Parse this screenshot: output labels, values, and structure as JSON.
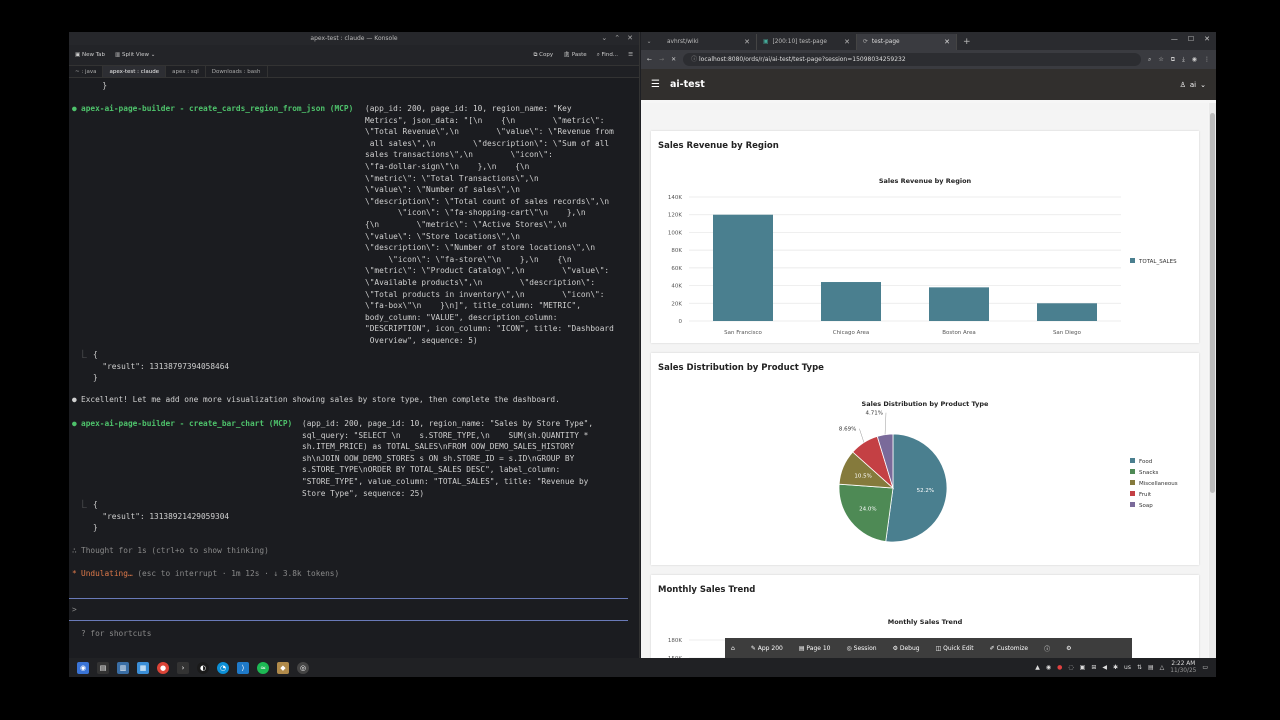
{
  "terminal": {
    "window_title": "apex-test : claude — Konsole",
    "toolbar": {
      "new_tab": "New Tab",
      "split_view": "Split View",
      "copy": "Copy",
      "paste": "Paste",
      "find": "Find..."
    },
    "tabs": [
      "~ : java",
      "apex-test : claude",
      "apex : sql",
      "Downloads : bash"
    ],
    "active_tab": "apex-test : claude",
    "lines": {
      "l0": "  }",
      "call1_name": "apex-ai-page-builder - create_cards_region_from_json (MCP)",
      "call1_args": [
        "(app_id: 200, page_id: 10, region_name: \"Key",
        "Metrics\", json_data: \"[\\n    {\\n        \\\"metric\\\":",
        "\\\"Total Revenue\\\",\\n        \\\"value\\\": \\\"Revenue from",
        " all sales\\\",\\n        \\\"description\\\": \\\"Sum of all",
        "sales transactions\\\",\\n        \\\"icon\\\":",
        "\\\"fa-dollar-sign\\\"\\n    },\\n    {\\n",
        "\\\"metric\\\": \\\"Total Transactions\\\",\\n",
        "\\\"value\\\": \\\"Number of sales\\\",\\n",
        "\\\"description\\\": \\\"Total count of sales records\\\",\\n",
        "       \\\"icon\\\": \\\"fa-shopping-cart\\\"\\n    },\\n",
        "{\\n        \\\"metric\\\": \\\"Active Stores\\\",\\n",
        "\\\"value\\\": \\\"Store locations\\\",\\n",
        "\\\"description\\\": \\\"Number of store locations\\\",\\n",
        "     \\\"icon\\\": \\\"fa-store\\\"\\n    },\\n    {\\n",
        "\\\"metric\\\": \\\"Product Catalog\\\",\\n        \\\"value\\\":",
        "\\\"Available products\\\",\\n        \\\"description\\\":",
        "\\\"Total products in inventory\\\",\\n        \\\"icon\\\":",
        "\\\"fa-box\\\"\\n    }\\n]\", title_column: \"METRIC\",",
        "body_column: \"VALUE\", description_column:",
        "\"DESCRIPTION\", icon_column: \"ICON\", title: \"Dashboard",
        " Overview\", sequence: 5)"
      ],
      "result1": [
        "{",
        "  \"result\": 13138797394058464",
        "}"
      ],
      "message": "Excellent! Let me add one more visualization showing sales by store type, then complete the dashboard.",
      "call2_name": "apex-ai-page-builder - create_bar_chart (MCP)",
      "call2_args": [
        "(app_id: 200, page_id: 10, region_name: \"Sales by Store Type\",",
        "sql_query: \"SELECT \\n    s.STORE_TYPE,\\n    SUM(sh.QUANTITY *",
        "sh.ITEM_PRICE) as TOTAL_SALES\\nFROM OOW_DEMO_SALES_HISTORY",
        "sh\\nJOIN OOW_DEMO_STORES s ON sh.STORE_ID = s.ID\\nGROUP BY",
        "s.STORE_TYPE\\nORDER BY TOTAL_SALES DESC\", label_column:",
        "\"STORE_TYPE\", value_column: \"TOTAL_SALES\", title: \"Revenue by",
        "Store Type\", sequence: 25)"
      ],
      "result2": [
        "{",
        "  \"result\": 13138921429059304",
        "}"
      ],
      "thought": "Thought for 1s (ctrl+o to show thinking)",
      "status_word": "Undulating…",
      "status_rest": " (esc to interrupt · 1m 12s · ↓ 3.8k tokens)",
      "prompt": ">",
      "shortcuts": "? for shortcuts"
    }
  },
  "browser": {
    "tabs": [
      {
        "label": "avhrst/wiki"
      },
      {
        "label": "[200:10] test-page"
      },
      {
        "label": "test-page"
      }
    ],
    "url": "localhost:8080/ords/r/ai/ai-test/test-page?session=15098034259232",
    "app_title": "ai-test",
    "user": "ai",
    "devbar": [
      "App 200",
      "Page 10",
      "Session",
      "Debug",
      "Quick Edit",
      "Customize"
    ]
  },
  "cards": [
    {
      "title": "Sales Revenue by Region"
    },
    {
      "title": "Sales Distribution by Product Type"
    },
    {
      "title": "Monthly Sales Trend"
    }
  ],
  "chart_data": [
    {
      "type": "bar",
      "title": "Sales Revenue by Region",
      "categories": [
        "San Francisco",
        "Chicago Area",
        "Boston Area",
        "San Diego"
      ],
      "series": [
        {
          "name": "TOTAL_SALES",
          "values": [
            120000,
            44000,
            38000,
            20000
          ]
        }
      ],
      "yticks": [
        "0",
        "20K",
        "40K",
        "60K",
        "80K",
        "100K",
        "120K",
        "140K"
      ],
      "ylim": [
        0,
        140000
      ],
      "color": "#4a7f8f",
      "legend": "right"
    },
    {
      "type": "pie",
      "title": "Sales Distribution by Product Type",
      "labels": [
        "Food",
        "Snacks",
        "Miscellaneous",
        "Fruit",
        "Soap"
      ],
      "values": [
        52.2,
        24.0,
        10.5,
        8.69,
        4.71
      ],
      "label_text": [
        "52.2%",
        "24.0%",
        "10.5%",
        "8.69%",
        "4.71%"
      ],
      "colors": [
        "#4a7f8f",
        "#4e8a55",
        "#857a3c",
        "#c44044",
        "#7a6a9a"
      ],
      "legend": "right"
    },
    {
      "type": "line",
      "title": "Monthly Sales Trend",
      "yticks": [
        "150K",
        "180K"
      ]
    }
  ],
  "taskbar": {
    "time": "2:22 AM",
    "date": "11/30/25",
    "locale": "us"
  }
}
